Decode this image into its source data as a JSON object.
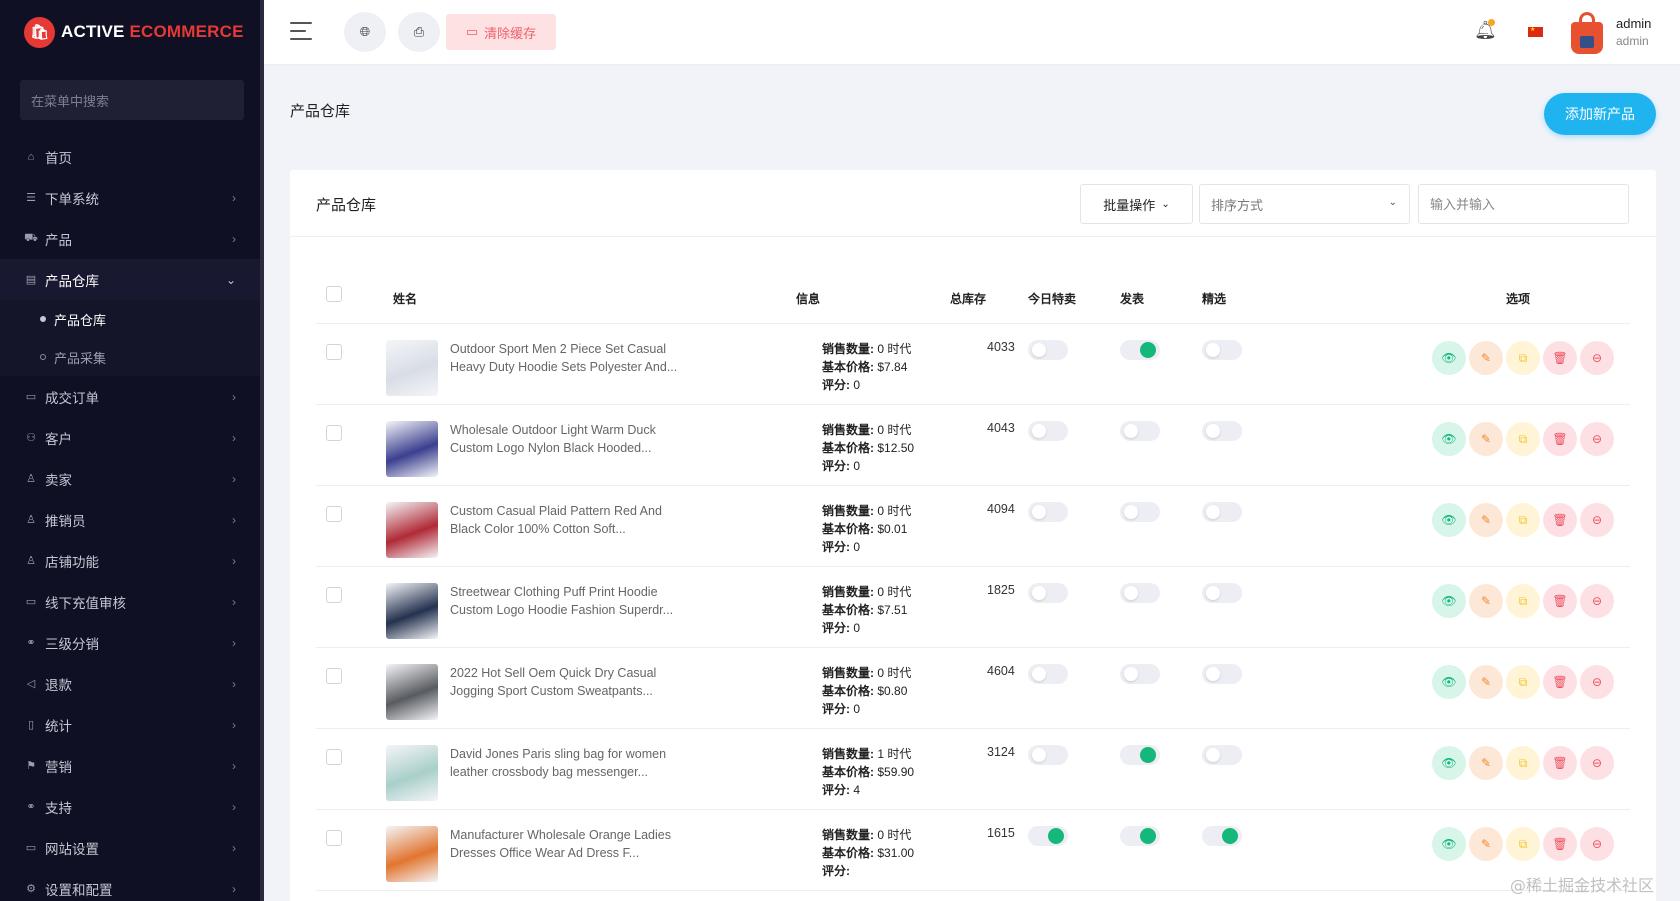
{
  "brand": {
    "badge": "🛍",
    "name_white": "ACTIVE ",
    "name_red": "ECOMMERCE"
  },
  "sidebar": {
    "search_placeholder": "在菜单中搜索",
    "items": [
      {
        "icon": "⌂",
        "icon_name": "home-icon",
        "label": "首页",
        "has_children": false
      },
      {
        "icon": "☰",
        "icon_name": "orders-system-icon",
        "label": "下单系统",
        "has_children": true
      },
      {
        "icon": "⛟",
        "icon_name": "cart-icon",
        "label": "产品",
        "has_children": true
      },
      {
        "icon": "▤",
        "icon_name": "warehouse-icon",
        "label": "产品仓库",
        "has_children": true,
        "open": true,
        "children": [
          {
            "label": "产品仓库",
            "active": true
          },
          {
            "label": "产品采集",
            "active": false
          }
        ]
      },
      {
        "icon": "▭",
        "icon_name": "deal-orders-icon",
        "label": "成交订单",
        "has_children": true
      },
      {
        "icon": "⚇",
        "icon_name": "customers-icon",
        "label": "客户",
        "has_children": true
      },
      {
        "icon": "♙",
        "icon_name": "seller-icon",
        "label": "卖家",
        "has_children": true
      },
      {
        "icon": "♙",
        "icon_name": "promoter-icon",
        "label": "推销员",
        "has_children": true
      },
      {
        "icon": "♙",
        "icon_name": "shop-icon",
        "label": "店铺功能",
        "has_children": true
      },
      {
        "icon": "▭",
        "icon_name": "recharge-icon",
        "label": "线下充值审核",
        "has_children": true
      },
      {
        "icon": "⚭",
        "icon_name": "link-icon",
        "label": "三级分销",
        "has_children": true
      },
      {
        "icon": "◁",
        "icon_name": "refund-icon",
        "label": "退款",
        "has_children": true
      },
      {
        "icon": "▯",
        "icon_name": "stats-icon",
        "label": "统计",
        "has_children": true
      },
      {
        "icon": "⚑",
        "icon_name": "marketing-icon",
        "label": "营销",
        "has_children": true
      },
      {
        "icon": "⚭",
        "icon_name": "support-icon",
        "label": "支持",
        "has_children": true
      },
      {
        "icon": "▭",
        "icon_name": "monitor-icon",
        "label": "网站设置",
        "has_children": true
      },
      {
        "icon": "⚙",
        "icon_name": "settings-icon",
        "label": "设置和配置",
        "has_children": true
      }
    ]
  },
  "topbar": {
    "clear_cache_label": "清除缓存",
    "user_name": "admin",
    "user_role": "admin"
  },
  "page": {
    "title": "产品仓库",
    "add_button": "添加新产品"
  },
  "card": {
    "title": "产品仓库",
    "bulk_label": "批量操作",
    "sort_placeholder": "排序方式",
    "search_placeholder": "输入并输入",
    "columns": {
      "name": "姓名",
      "info": "信息",
      "stock": "总库存",
      "today_deal": "今日特卖",
      "publish": "发表",
      "featured": "精选",
      "options": "选项"
    },
    "info_labels": {
      "sold": "销售数量:",
      "unit": " 时代",
      "price": "基本价格:",
      "rating": "评分:"
    },
    "rows": [
      {
        "name": "Outdoor Sport Men 2 Piece Set Casual Heavy Duty Hoodie Sets Polyester And...",
        "sold": "0",
        "price": "$7.84",
        "rating": "0",
        "stock": "4033",
        "today": false,
        "publish": true,
        "featured": false,
        "thumb": "#d8dde6"
      },
      {
        "name": "Wholesale Outdoor Light Warm Duck Custom Logo Nylon Black Hooded...",
        "sold": "0",
        "price": "$12.50",
        "rating": "0",
        "stock": "4043",
        "today": false,
        "publish": false,
        "featured": false,
        "thumb": "#3b3f8f"
      },
      {
        "name": "Custom Casual Plaid Pattern Red And Black Color 100% Cotton Soft...",
        "sold": "0",
        "price": "$0.01",
        "rating": "0",
        "stock": "4094",
        "today": false,
        "publish": false,
        "featured": false,
        "thumb": "#b02a36"
      },
      {
        "name": "Streetwear Clothing Puff Print Hoodie Custom Logo Hoodie Fashion Superdr...",
        "sold": "0",
        "price": "$7.51",
        "rating": "0",
        "stock": "1825",
        "today": false,
        "publish": false,
        "featured": false,
        "thumb": "#24324f"
      },
      {
        "name": "2022 Hot Sell Oem Quick Dry Casual Jogging Sport Custom Sweatpants...",
        "sold": "0",
        "price": "$0.80",
        "rating": "0",
        "stock": "4604",
        "today": false,
        "publish": false,
        "featured": false,
        "thumb": "#585b60"
      },
      {
        "name": "David Jones Paris sling bag for women leather crossbody bag messenger...",
        "sold": "1",
        "price": "$59.90",
        "rating": "4",
        "stock": "3124",
        "today": false,
        "publish": true,
        "featured": false,
        "thumb": "#a9cfca"
      },
      {
        "name": "Manufacturer Wholesale Orange Ladies Dresses Office Wear Ad Dress F...",
        "sold": "0",
        "price": "$31.00",
        "rating": "",
        "stock": "1615",
        "today": true,
        "publish": true,
        "featured": true,
        "thumb": "#e2752f"
      }
    ]
  },
  "watermark": "@稀土掘金技术社区",
  "colors": {
    "accent": "#1fb3f0",
    "sidebar_bg": "#0f1024",
    "toggle_on": "#15b87a",
    "danger": "#ef4f5f"
  }
}
